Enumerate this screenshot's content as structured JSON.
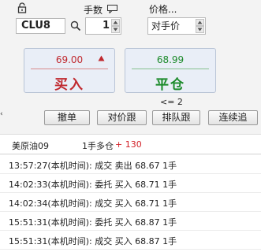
{
  "order": {
    "quantity_label": "手数",
    "price_label": "价格...",
    "symbol": "CLU8",
    "quantity": "1",
    "price_mode": "对手价"
  },
  "buy": {
    "price": "69.00",
    "label": "买入"
  },
  "close": {
    "price": "68.99",
    "label": "平仓"
  },
  "position_hint": "<= 2",
  "actions": {
    "cancel": "撤单",
    "chase_opp": "对价跟",
    "chase_queue": "排队跟",
    "chase_cont": "连续追"
  },
  "position": {
    "name": "美原油09",
    "direction": "1手多仓",
    "pnl": "+ 130"
  },
  "log": [
    "13:57:27(本机时间): 成交  卖出  68.67  1手",
    "14:02:33(本机时间): 委托  买入  68.71  1手",
    "14:02:34(本机时间): 成交  买入  68.71  1手",
    "15:51:31(本机时间): 委托  买入  68.87  1手",
    "15:51:31(本机时间): 成交  买入  68.87  1手"
  ],
  "colors": {
    "buy": "#c0282e",
    "close": "#1b8a2a",
    "pnl": "#d21f26"
  },
  "icons": {
    "lock": "lock-icon",
    "qty_tool": "chat-icon",
    "search": "search-icon",
    "arrow": "up-triangle-icon"
  }
}
